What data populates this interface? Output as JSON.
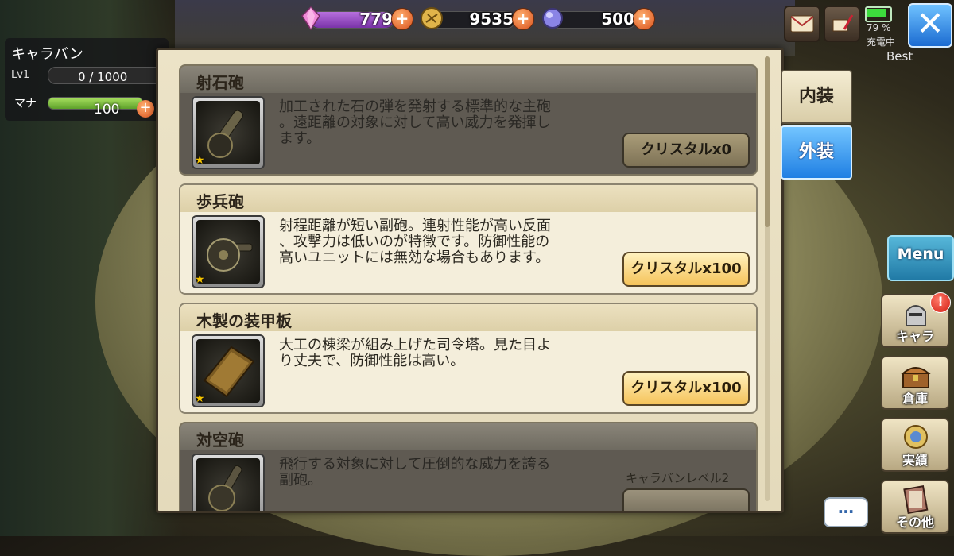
{
  "resources": {
    "gems": "779",
    "coins": "9535",
    "orbs": "500"
  },
  "device": {
    "battery_percent": "79 %",
    "charging_label": "充電中",
    "quality_label": "Best"
  },
  "caravan": {
    "name": "キャラバン",
    "level_label": "Lv1",
    "exp_text": "0 / 1000",
    "mana_label": "マナ",
    "mana_value": "100",
    "mana_fill": 1.0
  },
  "tabs": [
    {
      "label": "内装",
      "active": false
    },
    {
      "label": "外装",
      "active": true
    }
  ],
  "items": [
    {
      "name": "射石砲",
      "state": "owned",
      "stars": 1,
      "icon": "cannon-icon",
      "description": "加工された石の弾を発射する標準的な主砲\n。遠距離の対象に対して高い威力を発揮し\nます。",
      "button": "クリスタルx0"
    },
    {
      "name": "歩兵砲",
      "state": "available",
      "stars": 1,
      "icon": "infantry-gun-icon",
      "description": "射程距離が短い副砲。連射性能が高い反面\n、攻撃力は低いのが特徴です。防御性能の\n高いユニットには無効な場合もあります。",
      "button": "クリスタルx100"
    },
    {
      "name": "木製の装甲板",
      "state": "available",
      "stars": 1,
      "icon": "wooden-armor-plate-icon",
      "description": "大工の棟梁が組み上げた司令塔。見た目よ\nり丈夫で、防御性能は高い。",
      "button": "クリスタルx100"
    },
    {
      "name": "対空砲",
      "state": "locked",
      "stars": 1,
      "icon": "anti-air-gun-icon",
      "description": "飛行する対象に対して圧倒的な威力を誇る\n副砲。",
      "requirement": "キャラバンレベル2"
    }
  ],
  "side_menu": {
    "menu_label": "Menu",
    "buttons": [
      {
        "label": "キャラ",
        "icon": "knight-helmet-icon",
        "alert": "!"
      },
      {
        "label": "倉庫",
        "icon": "treasure-chest-icon"
      },
      {
        "label": "実績",
        "icon": "medal-icon"
      },
      {
        "label": "その他",
        "icon": "book-icon"
      }
    ]
  },
  "chat_label": "…",
  "colors": {
    "active_tab": "#1f7fe3",
    "plus_button": "#d9501c",
    "buy_button": "#f5c35a"
  }
}
